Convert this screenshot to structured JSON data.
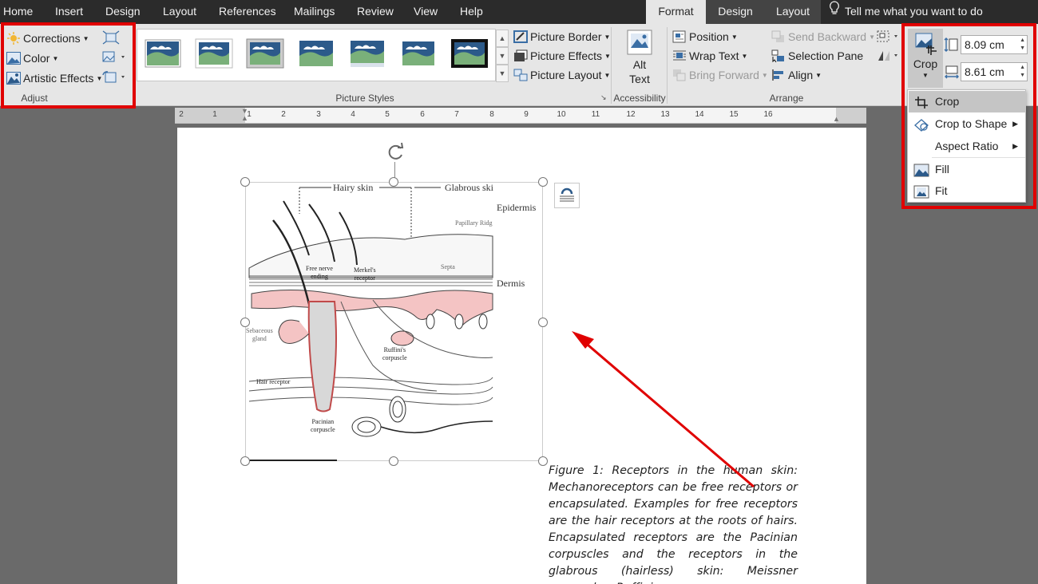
{
  "tabs": {
    "home": "Home",
    "insert": "Insert",
    "design": "Design",
    "layout": "Layout",
    "references": "References",
    "mailings": "Mailings",
    "review": "Review",
    "view": "View",
    "help": "Help",
    "format": "Format",
    "ctx_design": "Design",
    "ctx_layout": "Layout"
  },
  "tell_me": "Tell me what you want to do",
  "adjust": {
    "corrections": "Corrections",
    "color": "Color",
    "artistic_effects": "Artistic Effects",
    "label": "Adjust"
  },
  "picture_styles": {
    "label": "Picture Styles",
    "picture_border": "Picture Border",
    "picture_effects": "Picture Effects",
    "picture_layout": "Picture Layout"
  },
  "accessibility": {
    "alt_text_line1": "Alt",
    "alt_text_line2": "Text",
    "label": "Accessibility"
  },
  "arrange": {
    "position": "Position",
    "wrap_text": "Wrap Text",
    "bring_forward": "Bring Forward",
    "send_backward": "Send Backward",
    "selection_pane": "Selection Pane",
    "align": "Align",
    "label": "Arrange"
  },
  "size": {
    "crop": "Crop",
    "height": "8.09 cm",
    "width": "8.61 cm"
  },
  "crop_menu": {
    "crop": "Crop",
    "crop_to_shape": "Crop to Shape",
    "aspect_ratio": "Aspect Ratio",
    "fill": "Fill",
    "fit": "Fit"
  },
  "ruler_numbers": [
    "2",
    "1",
    "1",
    "2",
    "3",
    "4",
    "5",
    "6",
    "7",
    "8",
    "9",
    "10",
    "11",
    "12",
    "13",
    "14",
    "15",
    "16"
  ],
  "figure": {
    "hairy_skin": "Hairy skin",
    "glabrous_skin": "Glabrous ski",
    "epidermis": "Epidermis",
    "dermis": "Dermis",
    "papillary_ridges": "Papillary Ridg",
    "septa": "Septa",
    "free_nerve_ending_1": "Free nerve",
    "free_nerve_ending_2": "ending",
    "merkels_receptor_1": "Merkel's",
    "merkels_receptor_2": "receptor",
    "sebaceous_gland_1": "Sebaceous",
    "sebaceous_gland_2": "gland",
    "ruffinis_corpuscle_1": "Ruffini's",
    "ruffinis_corpuscle_2": "corpuscle",
    "hair_receptor": "Hair receptor",
    "pacinian_corpuscle_1": "Pacinian",
    "pacinian_corpuscle_2": "corpuscle"
  },
  "caption": "Figure 1: Receptors in the human skin: Mechanoreceptors can be free receptors or encapsulated. Examples for free receptors are the hair receptors at the roots of hairs. Encapsulated receptors are the Pacinian corpuscles and the receptors in the glabrous (hairless) skin: Meissner corpuscles, Ruffini",
  "colors": {
    "highlight_box": "#e00000",
    "tab_bar": "#2b2b2b",
    "ribbon": "#e6e6e6",
    "skin_dermis": "#f4c4c4"
  },
  "icons": [
    "corrections-icon",
    "color-icon",
    "artistic-effects-icon",
    "compress-pictures-icon",
    "change-picture-icon",
    "reset-picture-icon",
    "picture-border-icon",
    "picture-effects-icon",
    "picture-layout-icon",
    "alt-text-icon",
    "position-icon",
    "wrap-text-icon",
    "bring-forward-icon",
    "send-backward-icon",
    "selection-pane-icon",
    "align-icon",
    "group-icon",
    "rotate-icon",
    "crop-icon",
    "height-icon",
    "width-icon",
    "crop-to-shape-icon",
    "fill-icon",
    "fit-icon",
    "layout-options-icon",
    "rotate-handle-icon",
    "lightbulb-icon"
  ]
}
